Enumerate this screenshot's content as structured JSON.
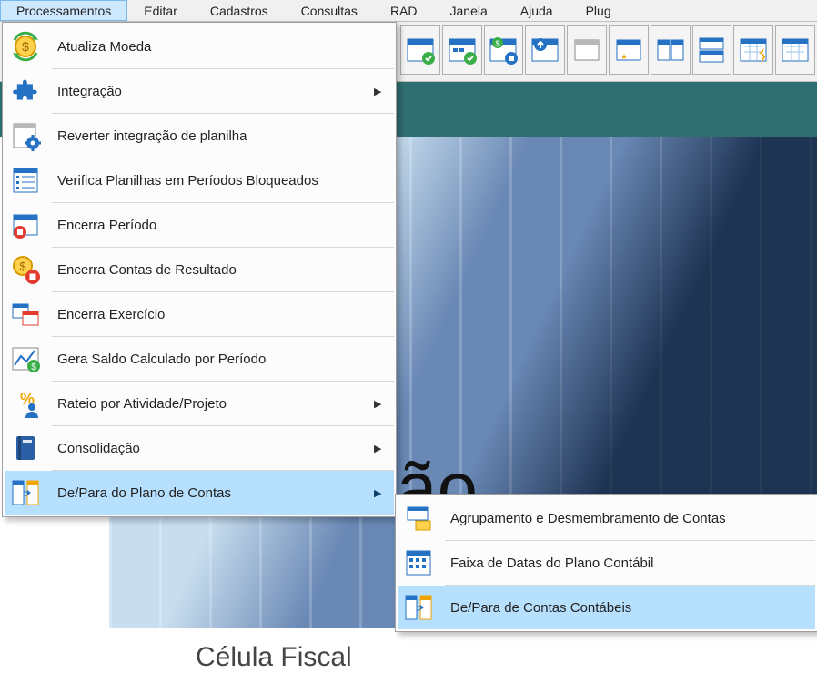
{
  "menubar": {
    "items": [
      {
        "label": "Processamentos",
        "active": true
      },
      {
        "label": "Editar"
      },
      {
        "label": "Cadastros"
      },
      {
        "label": "Consultas"
      },
      {
        "label": "RAD"
      },
      {
        "label": "Janela"
      },
      {
        "label": "Ajuda"
      },
      {
        "label": "Plug"
      }
    ]
  },
  "menu": {
    "items": [
      {
        "icon": "currency-refresh-icon",
        "label": "Atualiza Moeda"
      },
      {
        "icon": "puzzle-icon",
        "label": "Integração",
        "submenu": true
      },
      {
        "icon": "sheet-gear-icon",
        "label": "Reverter integração de planilha"
      },
      {
        "icon": "sheet-list-icon",
        "label": "Verifica Planilhas em Períodos Bloqueados"
      },
      {
        "icon": "calendar-stop-icon",
        "label": "Encerra Período"
      },
      {
        "icon": "currency-stop-icon",
        "label": "Encerra Contas de Resultado"
      },
      {
        "icon": "calendar-range-icon",
        "label": "Encerra Exercício"
      },
      {
        "icon": "chart-money-icon",
        "label": "Gera Saldo Calculado por Período"
      },
      {
        "icon": "percent-people-icon",
        "label": "Rateio por Atividade/Projeto",
        "submenu": true
      },
      {
        "icon": "book-icon",
        "label": "Consolidação",
        "submenu": true
      },
      {
        "icon": "mapping-icon",
        "label": "De/Para do Plano de Contas",
        "submenu": true,
        "highlight": true
      }
    ]
  },
  "submenu": {
    "items": [
      {
        "icon": "group-accounts-icon",
        "label": "Agrupamento e Desmembramento de Contas"
      },
      {
        "icon": "date-range-plan-icon",
        "label": "Faixa de Datas do Plano Contábil"
      },
      {
        "icon": "mapping-icon",
        "label": "De/Para de Contas Contábeis",
        "highlight": true
      }
    ]
  },
  "background": {
    "big_text_fragment": "ão",
    "sub_text": "Célula Fiscal"
  },
  "toolbar": {
    "buttons": [
      "calendar-check-1-icon",
      "calendar-check-2-icon",
      "calendar-dollar-stop-icon",
      "calendar-upload-icon",
      "window-plain-icon",
      "window-star-icon",
      "split-vertical-icon",
      "split-horizontal-icon",
      "grid-bolt-icon",
      "grid-plain-icon"
    ]
  }
}
